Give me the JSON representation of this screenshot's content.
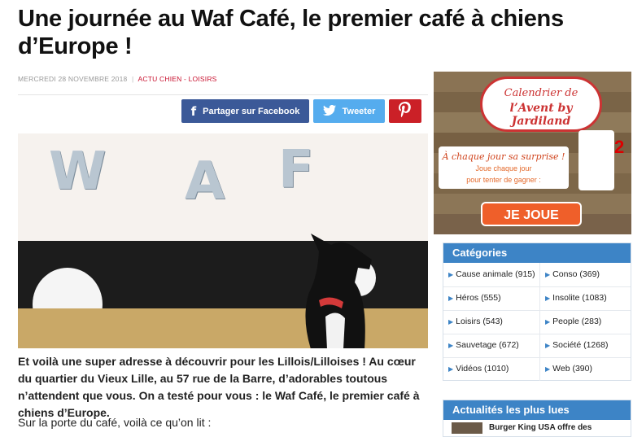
{
  "article": {
    "title_line1": "Une journée au Waf Café, le premier café à chiens",
    "title_line2": "d’Europe !",
    "date": "MERCREDI 28 NOVEMBRE 2018",
    "separator": "|",
    "category": "ACTU CHIEN - LOISIRS",
    "intro": "Et voilà une super adresse à découvrir pour les Lillois/Lilloises ! Au cœur du quartier du Vieux Lille, au 57 rue de la Barre, d’adorables toutous n’attendent que vous. On a testé pour vous : le Waf Café, le premier café à chiens d’Europe.",
    "para2": "Sur la porte du café, voilà ce qu’on lit :"
  },
  "share": {
    "facebook": "Partager sur Facebook",
    "twitter": "Tweeter",
    "pinterest_icon": "pinterest-icon"
  },
  "hero": {
    "balloon_letters": [
      "W",
      "A",
      "F"
    ]
  },
  "ad": {
    "badge_line1": "Calendrier de",
    "badge_line2": "l’Avent by Jardiland",
    "tagline": "À chaque jour sa surprise !",
    "sub1": "Joue chaque jour",
    "sub2": "pour tenter de gagner :",
    "cta": "JE JOUE",
    "number": "2"
  },
  "sidebar": {
    "categories_title": "Catégories",
    "categories": [
      {
        "label": "Cause animale (915)"
      },
      {
        "label": "Conso (369)"
      },
      {
        "label": "Héros (555)"
      },
      {
        "label": "Insolite (1083)"
      },
      {
        "label": "Loisirs (543)"
      },
      {
        "label": "People (283)"
      },
      {
        "label": "Sauvetage (672)"
      },
      {
        "label": "Société (1268)"
      },
      {
        "label": "Vidéos (1010)"
      },
      {
        "label": "Web (390)"
      }
    ],
    "popular_title": "Actualités les plus lues",
    "popular_first": "Burger King USA offre des"
  },
  "colors": {
    "facebook": "#3b5998",
    "twitter": "#55acee",
    "pinterest": "#cb2027",
    "sidebar_header": "#3d84c6",
    "category_link": "#c8102e"
  }
}
